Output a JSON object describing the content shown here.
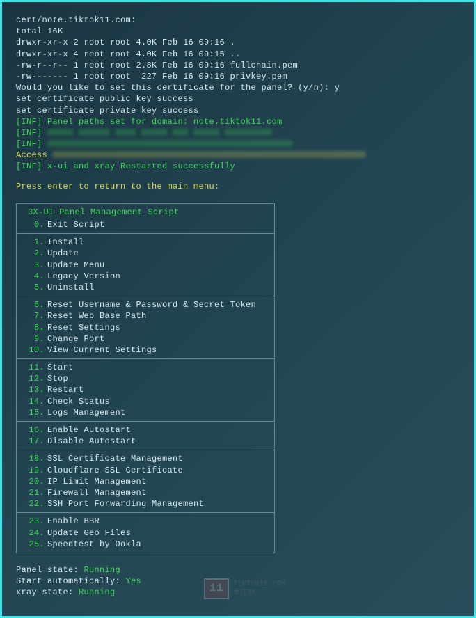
{
  "output": {
    "ls_header": "cert/note.tiktok11.com:",
    "total": "total 16K",
    "rows": [
      "drwxr-xr-x 2 root root 4.0K Feb 16 09:16 .",
      "drwxr-xr-x 4 root root 4.0K Feb 16 09:15 ..",
      "-rw-r--r-- 1 root root 2.8K Feb 16 09:16 fullchain.pem",
      "-rw------- 1 root root  227 Feb 16 09:16 privkey.pem"
    ],
    "prompt": "Would you like to set this certificate for the panel? (y/n): y",
    "pub_ok": "set certificate public key success",
    "priv_ok": "set certificate private key success",
    "inf_domain": "[INF] Panel paths set for domain: note.tiktok11.com",
    "inf_blur1_p": "[INF]",
    "inf_blur1_t": "XXXXX XXXXXX XXXX XXXXX XXX XXXXX XXXXXXXXX",
    "inf_blur2_p": "[INF]",
    "inf_blur2_t": "XXXXXXXXXXXXXXXXXXXXXXXXXXXXXXXXXXXXXXXXXXXXXXX",
    "access_p": "Access ",
    "access_t": "XXXXXXXXXXXXXXXXXXXXXXXXXXXXXXXXXXXXXXXXXXXXXXXXXXXXXXXXXXXX",
    "inf_restart": "[INF] x-ui and xray Restarted successfully",
    "return_prompt": "Press enter to return to the main menu:"
  },
  "menu": {
    "title": "3X-UI Panel Management Script",
    "sections": [
      [
        {
          "n": "0.",
          "l": "Exit Script"
        }
      ],
      [
        {
          "n": "1.",
          "l": "Install"
        },
        {
          "n": "2.",
          "l": "Update"
        },
        {
          "n": "3.",
          "l": "Update Menu"
        },
        {
          "n": "4.",
          "l": "Legacy Version"
        },
        {
          "n": "5.",
          "l": "Uninstall"
        }
      ],
      [
        {
          "n": "6.",
          "l": "Reset Username & Password & Secret Token"
        },
        {
          "n": "7.",
          "l": "Reset Web Base Path"
        },
        {
          "n": "8.",
          "l": "Reset Settings"
        },
        {
          "n": "9.",
          "l": "Change Port"
        },
        {
          "n": "10.",
          "l": "View Current Settings"
        }
      ],
      [
        {
          "n": "11.",
          "l": "Start"
        },
        {
          "n": "12.",
          "l": "Stop"
        },
        {
          "n": "13.",
          "l": "Restart"
        },
        {
          "n": "14.",
          "l": "Check Status"
        },
        {
          "n": "15.",
          "l": "Logs Management"
        }
      ],
      [
        {
          "n": "16.",
          "l": "Enable Autostart"
        },
        {
          "n": "17.",
          "l": "Disable Autostart"
        }
      ],
      [
        {
          "n": "18.",
          "l": "SSL Certificate Management"
        },
        {
          "n": "19.",
          "l": "Cloudflare SSL Certificate"
        },
        {
          "n": "20.",
          "l": "IP Limit Management"
        },
        {
          "n": "21.",
          "l": "Firewall Management"
        },
        {
          "n": "22.",
          "l": "SSH Port Forwarding Management"
        }
      ],
      [
        {
          "n": "23.",
          "l": "Enable BBR"
        },
        {
          "n": "24.",
          "l": "Update Geo Files"
        },
        {
          "n": "25.",
          "l": "Speedtest by Ookla"
        }
      ]
    ]
  },
  "status": {
    "panel_label": "Panel state: ",
    "panel_val": "Running",
    "auto_label": "Start automatically: ",
    "auto_val": "Yes",
    "xray_label": "xray state: ",
    "xray_val": "Running"
  },
  "watermark": {
    "num": "11",
    "t1": "TIKTOK11.COM",
    "t2": "专注TK"
  }
}
